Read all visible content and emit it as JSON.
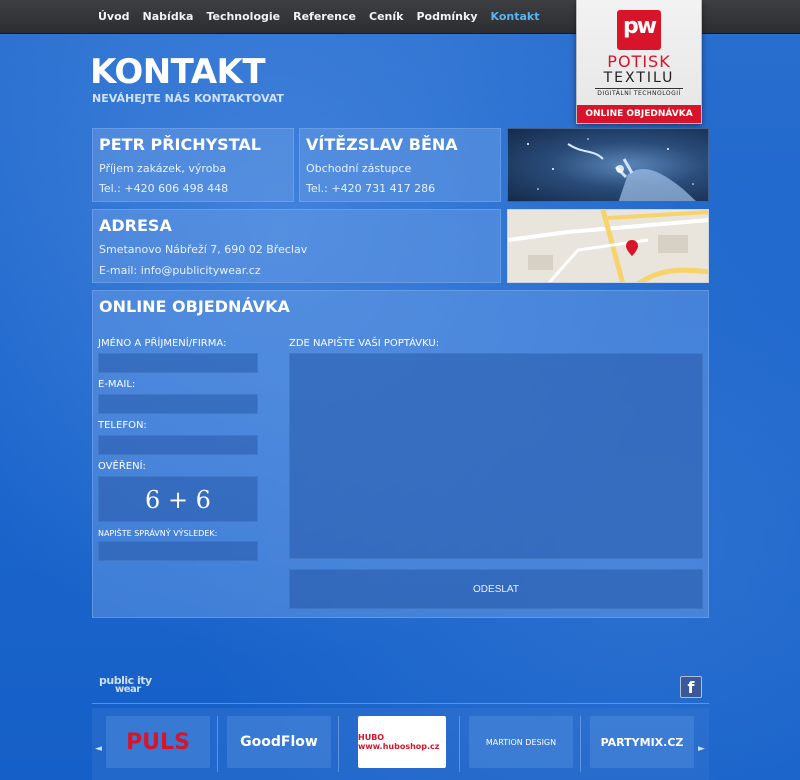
{
  "nav": {
    "items": [
      {
        "label": "Úvod"
      },
      {
        "label": "Nabídka"
      },
      {
        "label": "Technologie"
      },
      {
        "label": "Reference"
      },
      {
        "label": "Ceník"
      },
      {
        "label": "Podmínky"
      },
      {
        "label": "Kontakt",
        "active": true
      }
    ]
  },
  "logo": {
    "mark": "pw",
    "line1": "POTISK",
    "line2": "TEXTILU",
    "line3": "DIGITÁLNÍ TECHNOLOGIÍ",
    "band": "ONLINE OBJEDNÁVKA"
  },
  "header": {
    "title": "KONTAKT",
    "subtitle": "NEVÁHEJTE NÁS KONTAKTOVAT"
  },
  "contacts": [
    {
      "name": "PETR PŘICHYSTAL",
      "role": "Příjem zakázek, výroba",
      "phone": "Tel.: +420 606 498 448"
    },
    {
      "name": "VÍTĚZSLAV BĚNA",
      "role": "Obchodní zástupce",
      "phone": "Tel.: +420 731 417 286"
    }
  ],
  "address": {
    "title": "ADRESA",
    "street": "Smetanovo Nábřeží 7, 690 02 Břeclav",
    "email": "E-mail: info@publicitywear.cz"
  },
  "order_form": {
    "title": "ONLINE OBJEDNÁVKA",
    "name_label": "JMÉNO A PŘÍJMENÍ/FIRMA:",
    "email_label": "E-MAIL:",
    "phone_label": "TELEFON:",
    "verify_label": "OVĚŘENÍ:",
    "captcha": "6 + 6",
    "result_label": "NAPIŠTE SPRÁVNÝ VÝSLEDEK:",
    "message_label": "ZDE NAPIŠTE VAŠI POPTÁVKU:",
    "submit_label": "ODESLAT"
  },
  "footer": {
    "logo_top": "public ity",
    "logo_bottom": "wear",
    "facebook": "f",
    "partners": [
      {
        "name": "PULS",
        "color": "#d8142a"
      },
      {
        "name": "GoodFlow",
        "color": "#ffffff"
      },
      {
        "name": "HUBO www.huboshop.cz",
        "color": "#d8142a"
      },
      {
        "name": "MARTION DESIGN",
        "color": "#ffffff"
      },
      {
        "name": "PARTYMIX.CZ",
        "color": "#ffffff"
      }
    ],
    "prev_arrow": "◄",
    "next_arrow": "►"
  }
}
